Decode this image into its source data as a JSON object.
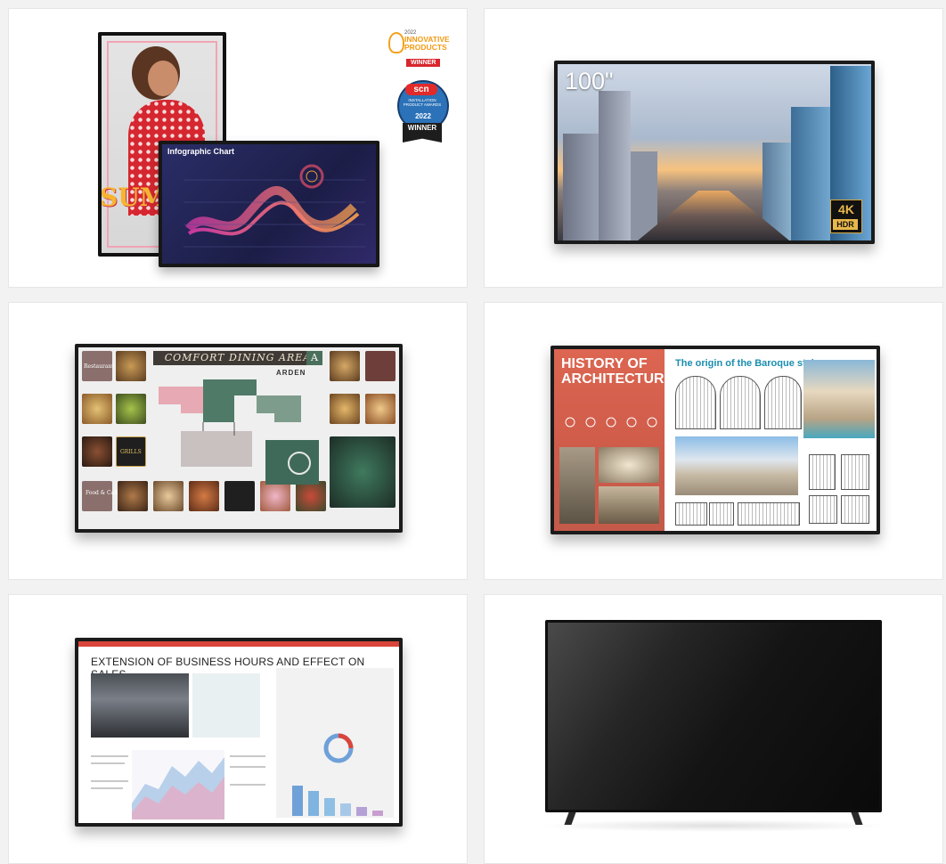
{
  "tile1": {
    "chart_title": "Infographic Chart",
    "sale_text": "SUM SA",
    "award1": {
      "year": "2022",
      "title": "INNOVATIVE PRODUCTS",
      "winner": "WINNER"
    },
    "award2": {
      "brand": "scn",
      "line": "INSTALLATION PRODUCT AWARDS",
      "year": "2022",
      "winner": "WINNER"
    }
  },
  "tile2": {
    "size_label": "100\"",
    "badge_top": "4K",
    "badge_bottom": "HDR"
  },
  "tile3": {
    "banner": "COMFORT DINING AREA",
    "marker": "A",
    "brand": "ARDEN",
    "labels": {
      "restaurant": "Restaurant",
      "food_cafe": "Food & Cafe",
      "grills": "GRILLS"
    }
  },
  "tile4": {
    "title": "HISTORY OF ARCHITECTURE",
    "subtitle": "The origin of the Baroque style"
  },
  "tile5": {
    "title": "EXTENSION OF BUSINESS HOURS AND EFFECT ON SALES"
  },
  "colors": {
    "page_bg": "#f2f2f2",
    "tile_bg": "#ffffff",
    "arch_accent": "#dc6651",
    "biz_accent": "#d9453a"
  }
}
